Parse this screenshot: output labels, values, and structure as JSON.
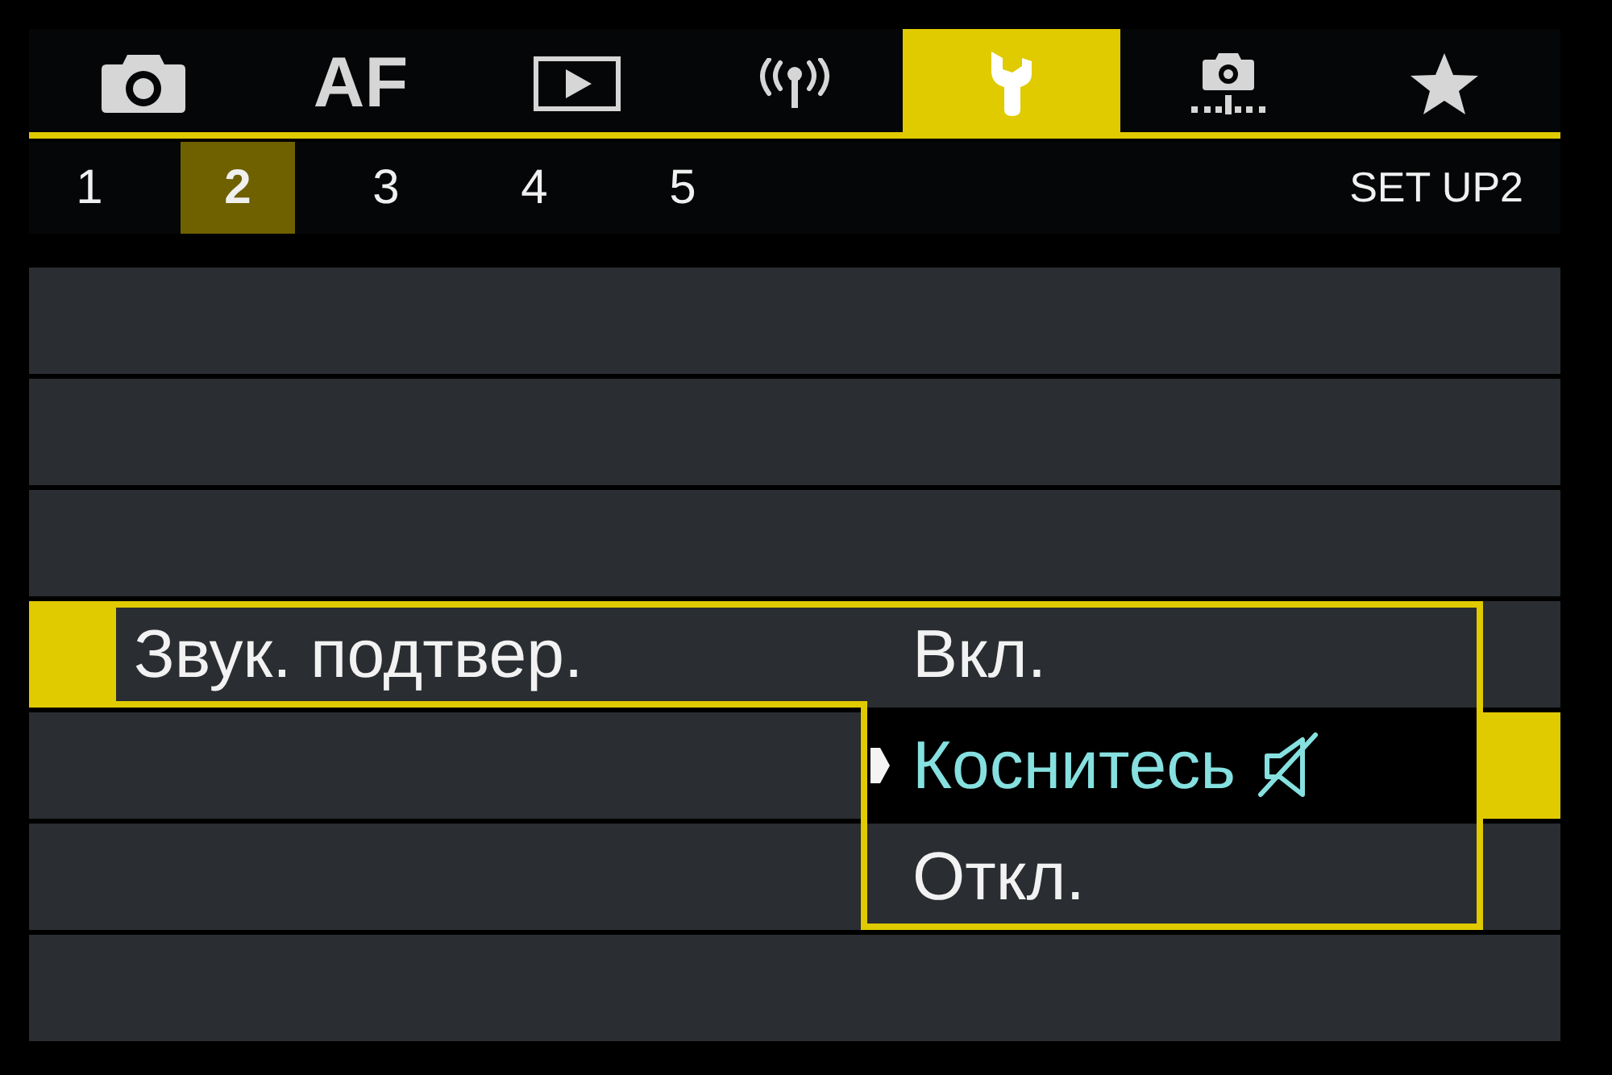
{
  "tabs": [
    {
      "kind": "shooting",
      "selected": false
    },
    {
      "kind": "af",
      "label": "AF",
      "selected": false
    },
    {
      "kind": "playback",
      "selected": false
    },
    {
      "kind": "wireless",
      "selected": false
    },
    {
      "kind": "setup",
      "selected": true
    },
    {
      "kind": "custom",
      "selected": false
    },
    {
      "kind": "my_menu",
      "selected": false
    }
  ],
  "pages": [
    {
      "label": "1",
      "selected": false
    },
    {
      "label": "2",
      "selected": true
    },
    {
      "label": "3",
      "selected": false
    },
    {
      "label": "4",
      "selected": false
    },
    {
      "label": "5",
      "selected": false
    }
  ],
  "page_title": "SET UP2",
  "menu_rows": [
    {
      "kind": "empty",
      "selected": false
    },
    {
      "kind": "empty",
      "selected": false
    },
    {
      "kind": "empty",
      "selected": false
    },
    {
      "kind": "setting",
      "selected": true,
      "label": "Звук. подтвер.",
      "options": [
        {
          "label": "Вкл.",
          "selected": false,
          "muted": false
        },
        {
          "label": "Коснитесь",
          "selected": true,
          "muted": true
        },
        {
          "label": "Откл.",
          "selected": false,
          "muted": false
        }
      ]
    },
    {
      "kind": "empty",
      "selected": false
    },
    {
      "kind": "empty",
      "selected": false
    },
    {
      "kind": "empty",
      "selected": false
    }
  ]
}
